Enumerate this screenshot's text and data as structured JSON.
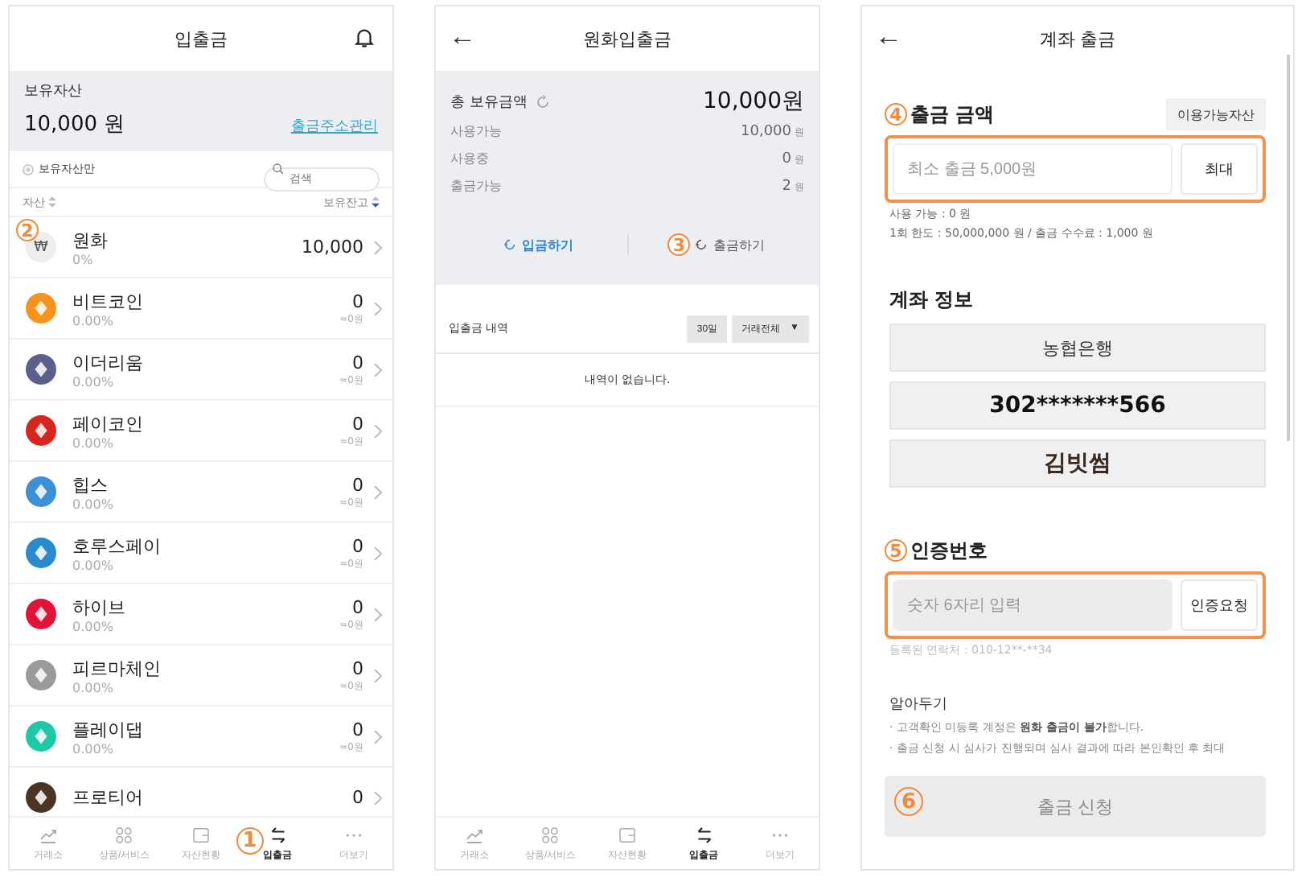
{
  "deposit_screen": {
    "title": "입출금",
    "holdings": {
      "label": "보유자산",
      "value": "10,000 원",
      "link": "출금주소관리"
    },
    "filter": {
      "label": "보유자산만",
      "checked": false
    },
    "search": {
      "placeholder": "검색"
    },
    "columns": [
      "자산",
      "보유잔고"
    ],
    "assets": [
      {
        "name": "원화",
        "change": "0%",
        "amount": "10,000",
        "symbol": "₩",
        "color": "#eeeeee",
        "marker": "2"
      },
      {
        "name": "비트코인",
        "change": "0.00%",
        "amount": "0",
        "krw": "≈0원",
        "color": "#f7931a"
      },
      {
        "name": "이더리움",
        "change": "0.00%",
        "amount": "0",
        "krw": "≈0원",
        "color": "#5c5f8c"
      },
      {
        "name": "페이코인",
        "change": "0.00%",
        "amount": "0",
        "krw": "≈0원",
        "color": "#d9261c"
      },
      {
        "name": "힙스",
        "change": "0.00%",
        "amount": "0",
        "krw": "≈0원",
        "color": "#3d8fd6"
      },
      {
        "name": "호루스페이",
        "change": "0.00%",
        "amount": "0",
        "krw": "≈0원",
        "color": "#2a8ad0"
      },
      {
        "name": "하이브",
        "change": "0.00%",
        "amount": "0",
        "krw": "≈0원",
        "color": "#e31337"
      },
      {
        "name": "피르마체인",
        "change": "0.00%",
        "amount": "0",
        "krw": "≈0원",
        "color": "#9a9a9a"
      },
      {
        "name": "플레이댑",
        "change": "0.00%",
        "amount": "0",
        "krw": "≈0원",
        "color": "#1ec8a5"
      },
      {
        "name": "프로티어",
        "amount": "0",
        "color": "#4a3426"
      }
    ],
    "nav": [
      {
        "label": "거래소",
        "selected": false
      },
      {
        "label": "상품/서비스",
        "selected": false
      },
      {
        "label": "자산현황",
        "selected": false
      },
      {
        "label": "입출금",
        "selected": true,
        "marker": "1"
      },
      {
        "label": "더보기",
        "selected": false
      }
    ]
  },
  "krw_screen": {
    "back": "←",
    "title": "원화입출금",
    "total_label": "총 보유금액",
    "total": "10,000원",
    "rows": [
      {
        "label": "사용가능",
        "value": "10,000",
        "unit": "원"
      },
      {
        "label": "사용중",
        "value": "0",
        "unit": "원"
      },
      {
        "label": "출금가능",
        "value": "2",
        "unit": "원"
      }
    ],
    "actions": [
      {
        "label": "입금하기",
        "selected": true
      },
      {
        "label": "출금하기",
        "selected": false,
        "marker": "3"
      }
    ],
    "history": {
      "label": "입출금 내역",
      "period": "30일",
      "type": "거래전체",
      "caret": "▼",
      "empty": "내역이 없습니다."
    },
    "nav": [
      {
        "label": "거래소",
        "selected": false
      },
      {
        "label": "상품/서비스",
        "selected": false
      },
      {
        "label": "자산현황",
        "selected": false
      },
      {
        "label": "입출금",
        "selected": true
      },
      {
        "label": "더보기",
        "selected": false
      }
    ]
  },
  "withdraw_screen": {
    "back": "←",
    "title": "계좌 출금",
    "amount": {
      "marker": "4",
      "label": "출금 금액",
      "assets_button": "이용가능자산",
      "placeholder": "최소 출금 5,000원",
      "button": "최대",
      "highlighted": true,
      "notes": [
        "사용 가능 : 0 원",
        "1회 한도 : 50,000,000 원 / 출금 수수료 : 1,000 원"
      ]
    },
    "account": {
      "label": "계좌 정보",
      "bank": "농협은행",
      "number": "302*******566",
      "holder": "김빗썸"
    },
    "auth": {
      "marker": "5",
      "label": "인증번호",
      "placeholder": "숫자 6자리 입력",
      "disabled": true,
      "button": "인증요청",
      "highlighted": true,
      "note": "등록된 연락처 : 010-12**-**34"
    },
    "tips": {
      "label": "알아두기",
      "items": [
        "· 고객확인 미등록 계정은 **원화 출금이 불가**합니다.",
        "· 출금 신청 시 심사가 진행되며 심사 결과에 따라 본인확인 후 최대"
      ]
    },
    "submit": {
      "label": "출금 신청",
      "disabled": true,
      "marker": "6"
    }
  }
}
